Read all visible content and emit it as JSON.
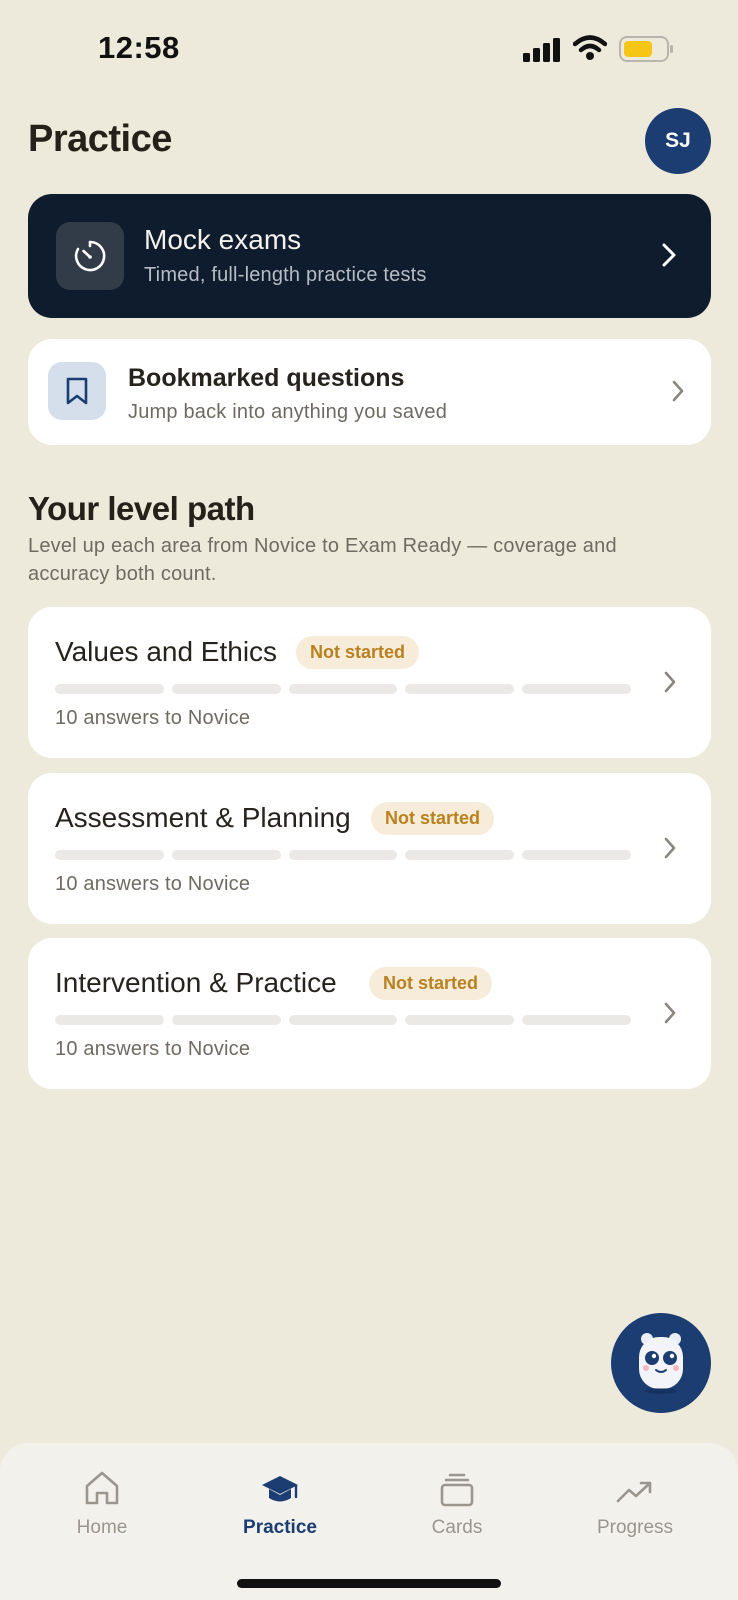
{
  "status_bar": {
    "time": "12:58"
  },
  "header": {
    "title": "Practice",
    "avatar_initials": "SJ"
  },
  "mock_exams": {
    "icon": "timer-icon",
    "title": "Mock exams",
    "subtitle": "Timed, full-length practice tests"
  },
  "bookmarked": {
    "icon": "bookmark-icon",
    "title": "Bookmarked questions",
    "subtitle": "Jump back into anything you saved"
  },
  "level_path": {
    "title": "Your level path",
    "description": "Level up each area from Novice to Exam Ready — coverage and accuracy both count.",
    "areas": [
      {
        "title": "Values and Ethics",
        "status": "Not started",
        "progress_segments_filled": 0,
        "progress_segments_total": 5,
        "subtitle": "10 answers to Novice"
      },
      {
        "title": "Assessment & Planning",
        "status": "Not started",
        "progress_segments_filled": 0,
        "progress_segments_total": 5,
        "subtitle": "10 answers to Novice"
      },
      {
        "title": "Intervention & Practice",
        "status": "Not started",
        "progress_segments_filled": 0,
        "progress_segments_total": 5,
        "subtitle": "10 answers to Novice"
      }
    ]
  },
  "assistant": {
    "icon": "mascot-icon"
  },
  "tabbar": {
    "active": "Practice",
    "tabs": [
      {
        "label": "Home",
        "icon": "home-icon"
      },
      {
        "label": "Practice",
        "icon": "graduation-cap-icon"
      },
      {
        "label": "Cards",
        "icon": "cards-icon"
      },
      {
        "label": "Progress",
        "icon": "trend-up-icon"
      }
    ]
  },
  "colors": {
    "background": "#edeadb",
    "accent": "#1b3d72",
    "dark_card": "#0f1c2e",
    "badge_text": "#b9811f",
    "badge_bg": "#f7ecd9"
  }
}
